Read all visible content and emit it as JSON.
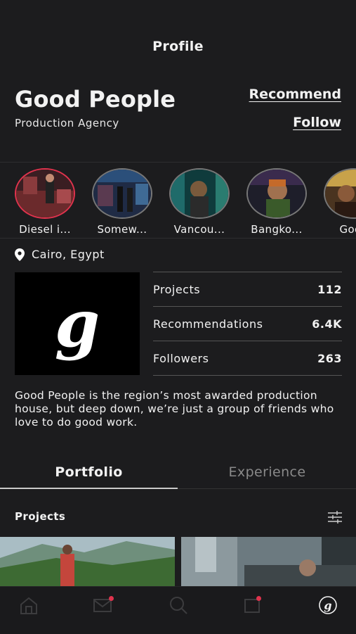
{
  "header": {
    "title": "Profile"
  },
  "profile": {
    "name": "Good People",
    "subtitle": "Production Agency",
    "recommend_label": "Recommend",
    "follow_label": "Follow",
    "location": "Cairo, Egypt",
    "logo_letter": "g",
    "bio": "Good People is the region’s most awarded production house, but deep down, we’re just a group of friends who love to do good work."
  },
  "stories": [
    {
      "label": "Diesel i..."
    },
    {
      "label": "Somew..."
    },
    {
      "label": "Vancou..."
    },
    {
      "label": "Bangko..."
    },
    {
      "label": "Good"
    }
  ],
  "stats": [
    {
      "label": "Projects",
      "value": "112"
    },
    {
      "label": "Recommendations",
      "value": "6.4K"
    },
    {
      "label": "Followers",
      "value": "263"
    }
  ],
  "tabs": {
    "portfolio": "Portfolio",
    "experience": "Experience"
  },
  "section": {
    "title": "Projects"
  },
  "colors": {
    "background": "#1c1c1e",
    "accent": "#e0334d",
    "text": "#f2f2f2"
  },
  "nav": [
    "home-icon",
    "inbox-icon",
    "search-icon",
    "notifications-icon",
    "profile-icon"
  ]
}
